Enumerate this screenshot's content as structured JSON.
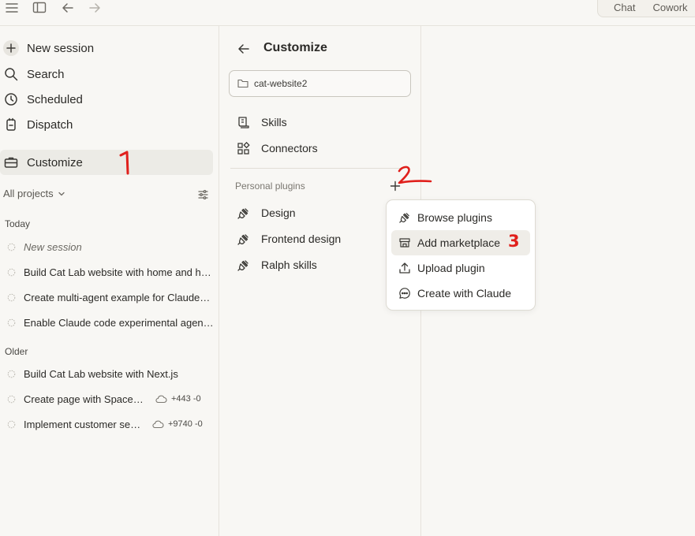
{
  "topbar": {
    "tabs": [
      "Chat",
      "Cowork"
    ]
  },
  "sidebar": {
    "nav": [
      {
        "label": "New session",
        "icon": "plus-icon"
      },
      {
        "label": "Search",
        "icon": "search-icon"
      },
      {
        "label": "Scheduled",
        "icon": "clock-icon"
      },
      {
        "label": "Dispatch",
        "icon": "phone-icon"
      },
      {
        "label": "Customize",
        "icon": "briefcase-icon",
        "active": true
      }
    ],
    "projects_filter": "All projects",
    "groups": [
      {
        "label": "Today",
        "sessions": [
          {
            "title": "New session",
            "italic": true
          },
          {
            "title": "Build Cat Lab website with home and h…"
          },
          {
            "title": "Create multi-agent example for Claude…"
          },
          {
            "title": "Enable Claude code experimental agen…"
          }
        ]
      },
      {
        "label": "Older",
        "sessions": [
          {
            "title": "Build Cat Lab website with Next.js"
          },
          {
            "title": "Create page with SpaceX l…",
            "diff": "+443 -0"
          },
          {
            "title": "Implement customer seg…",
            "diff": "+9740 -0"
          }
        ]
      }
    ]
  },
  "customize": {
    "title": "Customize",
    "project": "cat-website2",
    "items": [
      {
        "label": "Skills",
        "icon": "skills-icon"
      },
      {
        "label": "Connectors",
        "icon": "connectors-icon"
      }
    ],
    "plugins_label": "Personal plugins",
    "plugins": [
      {
        "label": "Design",
        "icon": "plug-icon"
      },
      {
        "label": "Frontend design",
        "icon": "plug-icon"
      },
      {
        "label": "Ralph skills",
        "icon": "plug-icon"
      }
    ]
  },
  "menu": {
    "items": [
      {
        "label": "Browse plugins",
        "icon": "plug-icon"
      },
      {
        "label": "Add marketplace",
        "icon": "store-icon",
        "hover": true
      },
      {
        "label": "Upload plugin",
        "icon": "upload-icon"
      },
      {
        "label": "Create with Claude",
        "icon": "chat-bubble-icon"
      }
    ]
  },
  "annotations": {
    "colors": {
      "annotation": "#e0201c"
    },
    "step3": "3"
  }
}
